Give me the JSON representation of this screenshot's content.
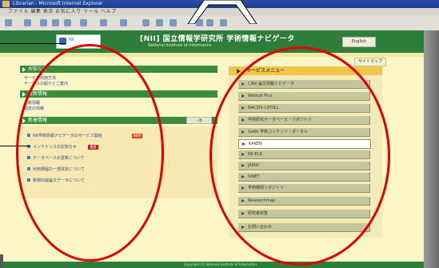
{
  "browser": {
    "title": "Librarian - Microsoft Internet Explorer",
    "menu": "ファイル 編集 表示 お気に入り ツール ヘルプ"
  },
  "header": {
    "logo_text": "NII",
    "site_title": "[NII] 国立情報学研究所 学術情報ナビゲータ",
    "subtitle": "National Institute of Informatics",
    "right_button": "English",
    "top_link": "サイトマップ"
  },
  "left": {
    "section1": "お知らせ",
    "section1_items": [
      "サービス利用方法",
      "サービスの紹介とご案内"
    ],
    "section2": "更新情報",
    "section2_items": [
      "最新情報",
      "過去の情報"
    ],
    "section3": "新着情報",
    "more_label": "一覧",
    "news": [
      {
        "text": "NII学術情報ナビゲータのサービス開始",
        "badge": "NEW",
        "badge_color": "#e8421c"
      },
      {
        "text": "メンテナンスのお知らせ",
        "badge": "重要",
        "badge_color": "#d0182a"
      },
      {
        "text": "データベースの更新について",
        "badge": "",
        "badge_color": ""
      },
      {
        "text": "利用規程の一部改定について",
        "badge": "",
        "badge_color": ""
      },
      {
        "text": "新規収録論文データについて",
        "badge": "",
        "badge_color": ""
      }
    ]
  },
  "right": {
    "header": "サービスメニュー",
    "items": [
      "CiNii 論文情報ナビゲータ",
      "Webcat Plus",
      "NACSIS-CAT/ILL",
      "学術研究データベース・リポジトリ",
      "GeNii 学術コンテンツ・ポータル",
      "KAKEN",
      "NII-ELS",
      "JAIRO",
      "SINET",
      "学術機関リポジトリ",
      "Researchmap",
      "研究者総覧",
      "お問い合わせ"
    ],
    "highlight_index": 5
  },
  "footer": {
    "text": "Copyright (C) National Institute of Informatics"
  },
  "colors": {
    "annotation": "#e00000",
    "header_green": "#2f7d3a",
    "content_bg": "#faf6c6"
  }
}
